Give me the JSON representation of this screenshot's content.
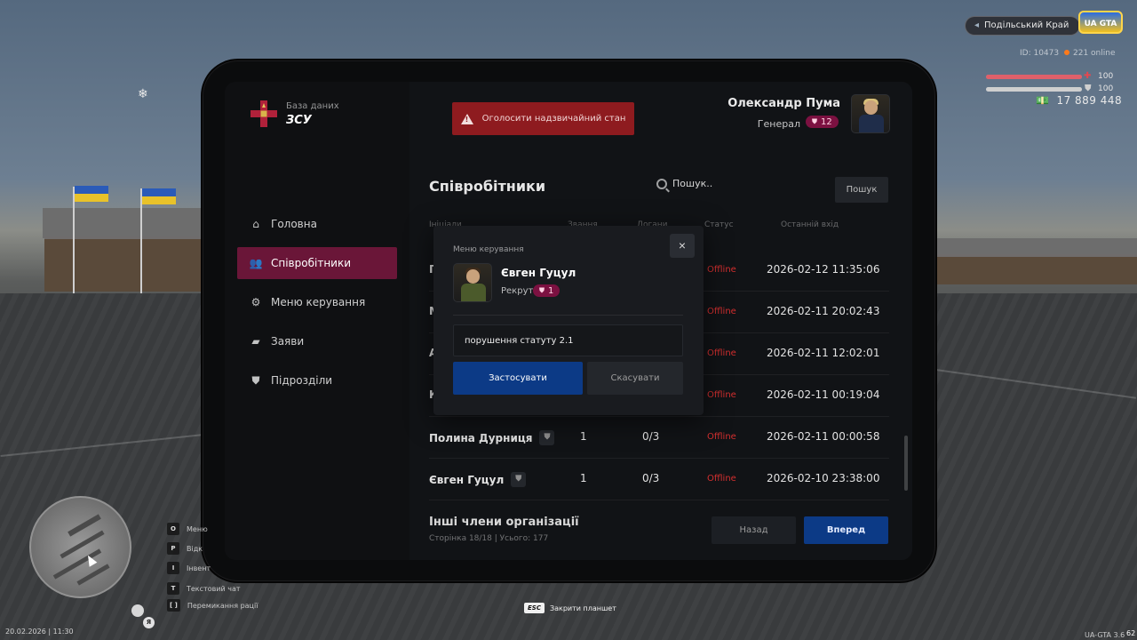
{
  "hud": {
    "server_name": "Подільський Край",
    "game_logo": "UA GTA",
    "player_id": "ID: 10473",
    "online": "221 online",
    "health_value": "100",
    "health_fraction": 1.0,
    "armor_value": "100",
    "armor_fraction": 1.0,
    "money": "17 889 448",
    "date_time": "20.02.2026 | 11:30",
    "version": "UA-GTA 3.6",
    "fps": "62",
    "esc_key": "ESC",
    "esc_hint": "Закрити планшет",
    "hotkeys": [
      {
        "key": "O",
        "label": "Меню"
      },
      {
        "key": "P",
        "label": "Відк"
      },
      {
        "key": "I",
        "label": "Інвент"
      },
      {
        "key": "T",
        "label": "Текстовий чат"
      },
      {
        "key": "[ ]",
        "label": "Перемикання рації"
      }
    ],
    "minimap_ya": "Я"
  },
  "tablet": {
    "org_subtitle": "База даних",
    "org_title": "ЗСУ",
    "emergency_button": "Оголосити надзвичайний стан",
    "user": {
      "name": "Олександр Пума",
      "rank": "Генерал",
      "rank_level": "12"
    },
    "nav": [
      {
        "label": "Головна",
        "icon": "home-icon"
      },
      {
        "label": "Співробітники",
        "icon": "users-icon",
        "active": true
      },
      {
        "label": "Меню керування",
        "icon": "gear-icon"
      },
      {
        "label": "Заяви",
        "icon": "folder-icon"
      },
      {
        "label": "Підрозділи",
        "icon": "shield-icon"
      }
    ],
    "section_title": "Співробітники",
    "search_placeholder": "Пошук..",
    "search_button": "Пошук",
    "table_headers": {
      "name": "Ініціали",
      "level": "Звання",
      "warns": "Догани",
      "status": "Статус",
      "last_login": "Останній вхід"
    },
    "rows": [
      {
        "name": "П",
        "level": "",
        "warns": "",
        "status": "Offline",
        "last_login": "2026-02-12 11:35:06"
      },
      {
        "name": "М",
        "level": "",
        "warns": "",
        "status": "Offline",
        "last_login": "2026-02-11 20:02:43"
      },
      {
        "name": "А",
        "level": "",
        "warns": "",
        "status": "Offline",
        "last_login": "2026-02-11 12:02:01"
      },
      {
        "name": "К",
        "level": "",
        "warns": "",
        "status": "Offline",
        "last_login": "2026-02-11 00:19:04"
      },
      {
        "name": "Полина Дурниця",
        "level": "1",
        "warns": "0/3",
        "status": "Offline",
        "last_login": "2026-02-11 00:00:58"
      },
      {
        "name": "Євген Гуцул",
        "level": "1",
        "warns": "0/3",
        "status": "Offline",
        "last_login": "2026-02-10 23:38:00"
      }
    ],
    "others_title": "Інші члени організації",
    "pagination_info": "Сторінка 18/18 | Усього: 177",
    "prev_button": "Назад",
    "next_button": "Вперед"
  },
  "modal": {
    "title": "Меню керування",
    "close_icon": "×",
    "target_name": "Євген Гуцул",
    "target_rank": "Рекрут",
    "target_rank_level": "1",
    "reason_value": "порушення статуту 2.1",
    "apply_button": "Застосувати",
    "cancel_button": "Скасувати"
  },
  "colors": {
    "accent_active_nav": "#6a1638",
    "primary_button": "#0c3a86",
    "danger": "#8e1b1f",
    "offline": "#d32f2f",
    "rank_badge": "#7c1141"
  }
}
